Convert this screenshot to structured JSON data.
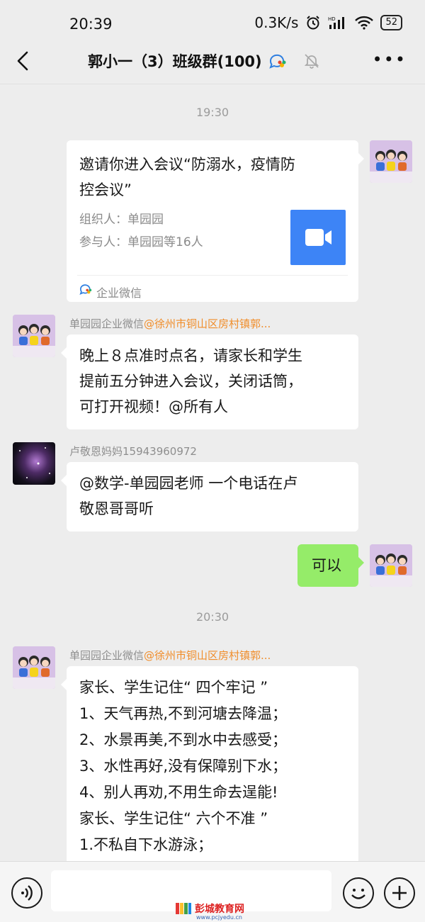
{
  "status_bar": {
    "time": "20:39",
    "network_speed": "0.3K/s",
    "battery": "52",
    "icons": [
      "alarm-icon",
      "hd-signal-icon",
      "wifi-icon",
      "battery-icon"
    ]
  },
  "navbar": {
    "title": "郭小一（3）班级群(100)",
    "icons": [
      "back-icon",
      "wecom-icon",
      "mute-bell-icon",
      "more-icon"
    ]
  },
  "messages": {
    "ts1": "19:30",
    "card": {
      "title_line1": "邀请你进入会议“防溺水，疫情防",
      "title_line2": "控会议”",
      "organizer": "组织人：单园园",
      "participants": "参与人：单园园等16人",
      "source": "企业微信"
    },
    "msg2": {
      "sender_name": "单园园企业微信",
      "sender_tag": "@徐州市铜山区房村镇郭...",
      "lines": [
        "晚上８点准时点名，请家长和学生",
        "提前五分钟进入会议，关闭话筒，",
        "可打开视频！@所有人"
      ]
    },
    "msg3": {
      "sender_name": "卢敬恩妈妈15943960972",
      "lines": [
        "@数学-单园园老师  一个电话在卢",
        "敬恩哥哥听"
      ]
    },
    "msg4": {
      "text": "可以"
    },
    "ts2": "20:30",
    "msg5": {
      "sender_name": "单园园企业微信",
      "sender_tag": "@徐州市铜山区房村镇郭...",
      "lines": [
        "家长、学生记住“ 四个牢记 ”",
        "1、天气再热,不到河塘去降温；",
        "2、水景再美,不到水中去感受；",
        "3、水性再好,没有保障别下水；",
        "4、别人再劝,不用生命去逞能!",
        "家长、学生记住“ 六个不准 ”",
        "1.不私自下水游泳；"
      ]
    }
  },
  "input_bar": {
    "icons": [
      "voice-icon",
      "emoji-icon",
      "plus-icon"
    ]
  },
  "watermark": {
    "text": "彭城教育网",
    "url": "www.pcjyedu.cn"
  },
  "colors": {
    "background": "#ededed",
    "self_bubble": "#95ec69",
    "sender_tag": "#f08d2a",
    "meeting_icon": "#3d84f6"
  }
}
